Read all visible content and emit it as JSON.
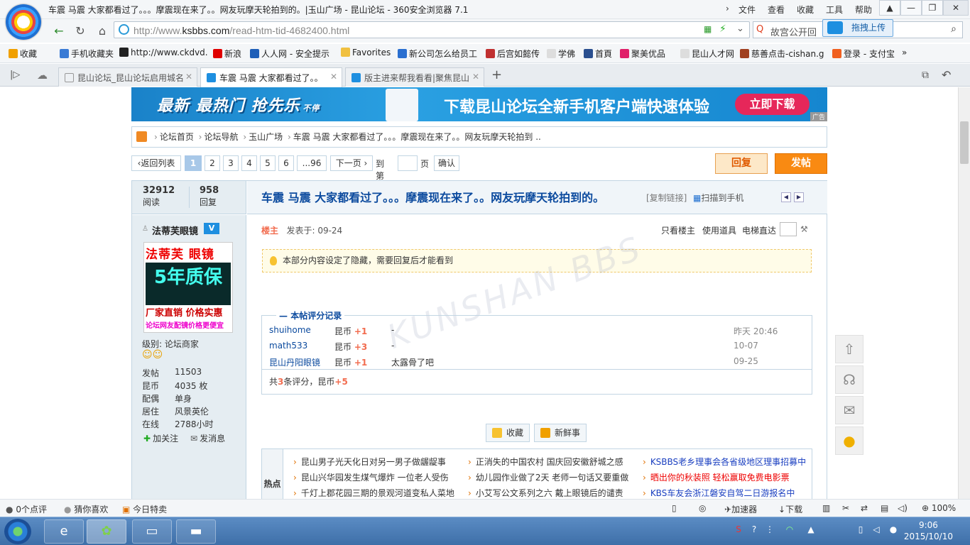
{
  "window": {
    "title": "车震 马震 大家都看过了。。。摩震现在来了。。网友玩摩天轮拍到的。|玉山广场 - 昆山论坛 - 360安全浏览器 7.1",
    "menu": [
      "文件",
      "查看",
      "收藏",
      "工具",
      "帮助"
    ]
  },
  "address": {
    "url_prefix": "http://www.",
    "url_domain": "ksbbs.com",
    "url_path": "/read-htm-tid-4682400.html",
    "search_text": "故宫公开回",
    "drag_upload": "拖拽上传"
  },
  "bookmarks": [
    {
      "label": "收藏",
      "color": "#f0a000"
    },
    {
      "label": "手机收藏夹",
      "color": "#3a7bd5"
    },
    {
      "label": "http://www.ckdvd.",
      "color": "#222222"
    },
    {
      "label": "新浪",
      "color": "#e00000"
    },
    {
      "label": "人人网 - 安全提示",
      "color": "#1f5fb8"
    },
    {
      "label": "Favorites",
      "color": "#f0c040"
    },
    {
      "label": "新公司怎么给员工",
      "color": "#2a6fd0"
    },
    {
      "label": "后宫如懿传",
      "color": "#c03030"
    },
    {
      "label": "学佛",
      "color": "#dddddd"
    },
    {
      "label": "首頁",
      "color": "#2a4f8f"
    },
    {
      "label": "聚美优品",
      "color": "#e0206a"
    },
    {
      "label": "昆山人才网",
      "color": "#dddddd"
    },
    {
      "label": "慈善点击-cishan.g",
      "color": "#a04020"
    },
    {
      "label": "登录 - 支付宝",
      "color": "#f06020"
    }
  ],
  "tabs": [
    {
      "label": "昆山论坛_昆山论坛启用城名",
      "active": false
    },
    {
      "label": "车震 马震 大家都看过了。。",
      "active": true
    },
    {
      "label": "版主进来帮我看看|聚焦昆山",
      "active": false
    }
  ],
  "banner": {
    "left_text": "最新 最热门 抢先乐",
    "left_small": "不停",
    "main_text": "下载昆山论坛全新手机客户端快速体验",
    "button": "立即下载",
    "ad_tag": "广告"
  },
  "breadcrumb": [
    "论坛首页",
    "论坛导航",
    "玉山广场",
    "车震 马震 大家都看过了。。。摩震现在来了。。网友玩摩天轮拍到 .."
  ],
  "pager": {
    "back": "‹返回列表",
    "pages": [
      "1",
      "2",
      "3",
      "4",
      "5",
      "6",
      "...96"
    ],
    "current": "1",
    "next": "下一页 ›",
    "goto_label": "到第",
    "page_unit": "页",
    "confirm": "确认"
  },
  "actions": {
    "reply": "回复",
    "post": "发帖"
  },
  "topic": {
    "views": "32912",
    "views_label": "阅读",
    "replies": "958",
    "replies_label": "回复",
    "title": "车震 马震 大家都看过了。。。摩震现在来了。。网友玩摩天轮拍到的。",
    "copy_link": "[复制链接]",
    "scan_phone": "扫描到手机"
  },
  "author": {
    "name": "法蒂芙眼镜",
    "badge": "V",
    "avatar_top": "法蒂芙 眼镜",
    "avatar_mid": "5年质保",
    "avatar_sub": "厂家直销 价格实惠",
    "avatar_foot": "论坛网友配镜价格更便宜",
    "level_label": "级别:",
    "level": "论坛商家",
    "info": [
      {
        "label": "发帖",
        "value": "11503"
      },
      {
        "label": "昆币",
        "value": "4035 枚"
      },
      {
        "label": "配偶",
        "value": "单身"
      },
      {
        "label": "居住",
        "value": "风景英伦"
      },
      {
        "label": "在线",
        "value": "2788小时"
      }
    ],
    "follow": "加关注",
    "message": "发消息"
  },
  "post": {
    "floor": "楼主",
    "posted_at": "发表于: 09-24",
    "only_author": "只看楼主",
    "use_tools": "使用道具",
    "elevator": "电梯直达",
    "hidden_note": "本部分内容设定了隐藏，需要回复后才能看到",
    "watermark": "KUNSHAN BBS"
  },
  "rating": {
    "legend": "本帖评分记录",
    "rows": [
      {
        "user": "shuihome",
        "currency": "昆币",
        "amount": "+1",
        "reason": "-",
        "time": "昨天 20:46"
      },
      {
        "user": "math533",
        "currency": "昆币",
        "amount": "+3",
        "reason": "-",
        "time": "10-07"
      },
      {
        "user": "昆山丹阳眼镜",
        "currency": "昆币",
        "amount": "+1",
        "reason": "太露骨了吧",
        "time": "09-25"
      }
    ],
    "summary_pre": "共",
    "summary_count": "3",
    "summary_mid": "条评分，昆币",
    "summary_total": "+5"
  },
  "buttons": {
    "favorite": "收藏",
    "fresh": "新鲜事"
  },
  "hot": {
    "label": "热点",
    "col1": [
      "昆山男子光天化日对另一男子做龌龊事",
      "昆山兴华园发生煤气爆炸 一位老人受伤",
      "千灯上郡花园三期的景观河道变私人菜地"
    ],
    "col2": [
      "正消失的中国农村 国庆回安徽舒城之感",
      "幼儿园作业做了2天 老师一句话又要重做",
      "小艾写公文系列之六 戴上眼镜后的谴责"
    ],
    "col3": [
      "KSBBS老乡理事会各省级地区理事招募中",
      "晒出你的秋装照 轻松赢取免费电影票",
      "KBS车友会浙江磐安自驾二日游报名中"
    ]
  },
  "statusbar": {
    "comments": "0个点评",
    "guess": "猜你喜欢",
    "today": "今日特卖",
    "accelerator": "加速器",
    "download": "下载",
    "zoom": "100%"
  },
  "taskbar": {
    "time": "9:06",
    "date": "2015/10/10"
  }
}
